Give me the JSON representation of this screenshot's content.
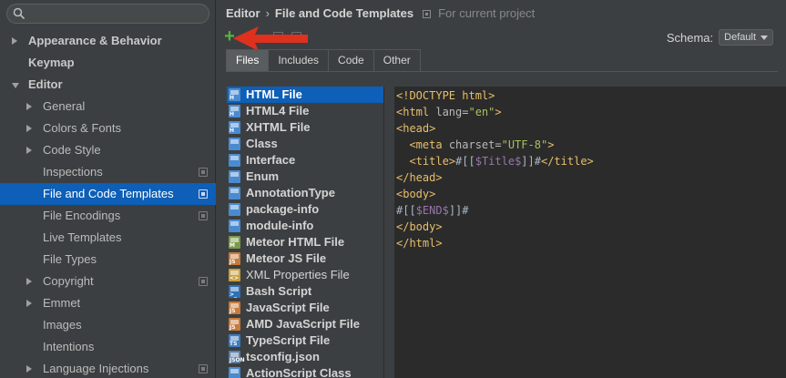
{
  "sidebar": {
    "search": {
      "placeholder": ""
    },
    "items": [
      {
        "label": "Appearance & Behavior",
        "level": 0,
        "bold": true,
        "arrow": "right",
        "project": false,
        "selected": false
      },
      {
        "label": "Keymap",
        "level": 0,
        "bold": true,
        "arrow": "none",
        "project": false,
        "selected": false
      },
      {
        "label": "Editor",
        "level": 0,
        "bold": true,
        "arrow": "down",
        "project": false,
        "selected": false
      },
      {
        "label": "General",
        "level": 1,
        "bold": false,
        "arrow": "right",
        "project": false,
        "selected": false
      },
      {
        "label": "Colors & Fonts",
        "level": 1,
        "bold": false,
        "arrow": "right",
        "project": false,
        "selected": false
      },
      {
        "label": "Code Style",
        "level": 1,
        "bold": false,
        "arrow": "right",
        "project": false,
        "selected": false
      },
      {
        "label": "Inspections",
        "level": 1,
        "bold": false,
        "arrow": "none",
        "project": true,
        "selected": false
      },
      {
        "label": "File and Code Templates",
        "level": 1,
        "bold": false,
        "arrow": "none",
        "project": true,
        "selected": true
      },
      {
        "label": "File Encodings",
        "level": 1,
        "bold": false,
        "arrow": "none",
        "project": true,
        "selected": false
      },
      {
        "label": "Live Templates",
        "level": 1,
        "bold": false,
        "arrow": "none",
        "project": false,
        "selected": false
      },
      {
        "label": "File Types",
        "level": 1,
        "bold": false,
        "arrow": "none",
        "project": false,
        "selected": false
      },
      {
        "label": "Copyright",
        "level": 1,
        "bold": false,
        "arrow": "right",
        "project": true,
        "selected": false
      },
      {
        "label": "Emmet",
        "level": 1,
        "bold": false,
        "arrow": "right",
        "project": false,
        "selected": false
      },
      {
        "label": "Images",
        "level": 1,
        "bold": false,
        "arrow": "none",
        "project": false,
        "selected": false
      },
      {
        "label": "Intentions",
        "level": 1,
        "bold": false,
        "arrow": "none",
        "project": false,
        "selected": false
      },
      {
        "label": "Language Injections",
        "level": 1,
        "bold": false,
        "arrow": "right",
        "project": true,
        "selected": false
      }
    ]
  },
  "breadcrumb": {
    "root": "Editor",
    "separator": "›",
    "current": "File and Code Templates",
    "scope": "For current project"
  },
  "toolbar": {
    "add_label": "+",
    "add_color": "#54b33e",
    "annotation_arrow_color": "#e0301e"
  },
  "schema": {
    "label": "Schema:",
    "value": "Default"
  },
  "tabs": [
    {
      "label": "Files",
      "active": true
    },
    {
      "label": "Includes",
      "active": false
    },
    {
      "label": "Code",
      "active": false
    },
    {
      "label": "Other",
      "active": false
    }
  ],
  "templates": [
    {
      "name": "HTML File",
      "icon": "html-file-icon",
      "color": "#4a8bd0",
      "tag": "H",
      "bold": true,
      "selected": true
    },
    {
      "name": "HTML4 File",
      "icon": "html-file-icon",
      "color": "#4a8bd0",
      "tag": "H",
      "bold": true,
      "selected": false
    },
    {
      "name": "XHTML File",
      "icon": "xhtml-file-icon",
      "color": "#4a8bd0",
      "tag": "H",
      "bold": true,
      "selected": false
    },
    {
      "name": "Class",
      "icon": "class-file-icon",
      "color": "#4a8bd0",
      "tag": "",
      "bold": true,
      "selected": false
    },
    {
      "name": "Interface",
      "icon": "interface-file-icon",
      "color": "#4a8bd0",
      "tag": "",
      "bold": true,
      "selected": false
    },
    {
      "name": "Enum",
      "icon": "enum-file-icon",
      "color": "#4a8bd0",
      "tag": "",
      "bold": true,
      "selected": false
    },
    {
      "name": "AnnotationType",
      "icon": "annotation-file-icon",
      "color": "#4a8bd0",
      "tag": "",
      "bold": true,
      "selected": false
    },
    {
      "name": "package-info",
      "icon": "package-info-icon",
      "color": "#4a8bd0",
      "tag": "",
      "bold": true,
      "selected": false
    },
    {
      "name": "module-info",
      "icon": "module-info-icon",
      "color": "#4a8bd0",
      "tag": "",
      "bold": true,
      "selected": false
    },
    {
      "name": "Meteor HTML File",
      "icon": "meteor-html-icon",
      "color": "#7a9a4a",
      "tag": "M",
      "bold": true,
      "selected": false
    },
    {
      "name": "Meteor JS File",
      "icon": "meteor-js-icon",
      "color": "#c77a3a",
      "tag": "JS",
      "bold": true,
      "selected": false
    },
    {
      "name": "XML Properties File",
      "icon": "xml-properties-icon",
      "color": "#c8a040",
      "tag": "<>",
      "bold": false,
      "selected": false
    },
    {
      "name": "Bash Script",
      "icon": "bash-script-icon",
      "color": "#2f6fb5",
      "tag": ">_",
      "bold": true,
      "selected": false
    },
    {
      "name": "JavaScript File",
      "icon": "javascript-file-icon",
      "color": "#c77a3a",
      "tag": "JS",
      "bold": true,
      "selected": false
    },
    {
      "name": "AMD JavaScript File",
      "icon": "amd-javascript-icon",
      "color": "#c77a3a",
      "tag": "JS",
      "bold": true,
      "selected": false
    },
    {
      "name": "TypeScript File",
      "icon": "typescript-file-icon",
      "color": "#3e7bc0",
      "tag": "TS",
      "bold": true,
      "selected": false
    },
    {
      "name": "tsconfig.json",
      "icon": "json-file-icon",
      "color": "#5a7fa8",
      "tag": "JSON",
      "bold": true,
      "selected": false
    },
    {
      "name": "ActionScript Class",
      "icon": "actionscript-icon",
      "color": "#4a8bd0",
      "tag": "",
      "bold": true,
      "selected": false
    }
  ],
  "editor": {
    "lines": [
      [
        {
          "k": "t",
          "x": "<!DOCTYPE "
        },
        {
          "k": "d",
          "x": "html"
        },
        {
          "k": "t",
          "x": ">"
        }
      ],
      [
        {
          "k": "t",
          "x": "<html "
        },
        {
          "k": "a",
          "x": "lang="
        },
        {
          "k": "s",
          "x": "\"en\""
        },
        {
          "k": "t",
          "x": ">"
        }
      ],
      [
        {
          "k": "t",
          "x": "<head>"
        }
      ],
      [
        {
          "k": "p",
          "x": "  "
        },
        {
          "k": "t",
          "x": "<meta "
        },
        {
          "k": "a",
          "x": "charset="
        },
        {
          "k": "s",
          "x": "\"UTF-8\""
        },
        {
          "k": "t",
          "x": ">"
        }
      ],
      [
        {
          "k": "p",
          "x": "  "
        },
        {
          "k": "t",
          "x": "<title>"
        },
        {
          "k": "p",
          "x": "#[["
        },
        {
          "k": "v",
          "x": "$Title$"
        },
        {
          "k": "p",
          "x": "]]#"
        },
        {
          "k": "t",
          "x": "</title>"
        }
      ],
      [
        {
          "k": "t",
          "x": "</head>"
        }
      ],
      [
        {
          "k": "t",
          "x": "<body>"
        }
      ],
      [
        {
          "k": "p",
          "x": "#[["
        },
        {
          "k": "v",
          "x": "$END$"
        },
        {
          "k": "p",
          "x": "]]#"
        }
      ],
      [
        {
          "k": "t",
          "x": "</body>"
        }
      ],
      [
        {
          "k": "t",
          "x": "</html>"
        }
      ]
    ]
  }
}
